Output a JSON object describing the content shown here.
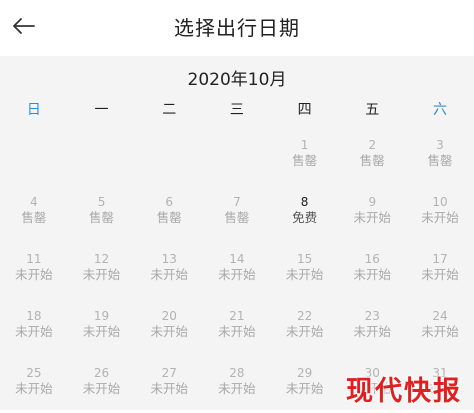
{
  "header": {
    "title": "选择出行日期",
    "back_icon": "arrow-left-icon"
  },
  "calendar": {
    "month_title": "2020年10月",
    "weekdays": [
      "日",
      "一",
      "二",
      "三",
      "四",
      "五",
      "六"
    ],
    "weekend_color": "#2a8fd6",
    "leading_blanks": 4,
    "days": [
      {
        "num": "1",
        "status": "售罄"
      },
      {
        "num": "2",
        "status": "售罄"
      },
      {
        "num": "3",
        "status": "售罄"
      },
      {
        "num": "4",
        "status": "售罄"
      },
      {
        "num": "5",
        "status": "售罄"
      },
      {
        "num": "6",
        "status": "售罄"
      },
      {
        "num": "7",
        "status": "售罄"
      },
      {
        "num": "8",
        "status": "免费",
        "available": true
      },
      {
        "num": "9",
        "status": "未开始"
      },
      {
        "num": "10",
        "status": "未开始"
      },
      {
        "num": "11",
        "status": "未开始"
      },
      {
        "num": "12",
        "status": "未开始"
      },
      {
        "num": "13",
        "status": "未开始"
      },
      {
        "num": "14",
        "status": "未开始"
      },
      {
        "num": "15",
        "status": "未开始"
      },
      {
        "num": "16",
        "status": "未开始"
      },
      {
        "num": "17",
        "status": "未开始"
      },
      {
        "num": "18",
        "status": "未开始"
      },
      {
        "num": "19",
        "status": "未开始"
      },
      {
        "num": "20",
        "status": "未开始"
      },
      {
        "num": "21",
        "status": "未开始"
      },
      {
        "num": "22",
        "status": "未开始"
      },
      {
        "num": "23",
        "status": "未开始"
      },
      {
        "num": "24",
        "status": "未开始"
      },
      {
        "num": "25",
        "status": "未开始"
      },
      {
        "num": "26",
        "status": "未开始"
      },
      {
        "num": "27",
        "status": "未开始"
      },
      {
        "num": "28",
        "status": "未开始"
      },
      {
        "num": "29",
        "status": "未开始"
      },
      {
        "num": "30",
        "status": "未开始"
      },
      {
        "num": "31",
        "status": "未开始"
      }
    ]
  },
  "watermark": {
    "text": "现代快报",
    "color": "#e02020"
  }
}
